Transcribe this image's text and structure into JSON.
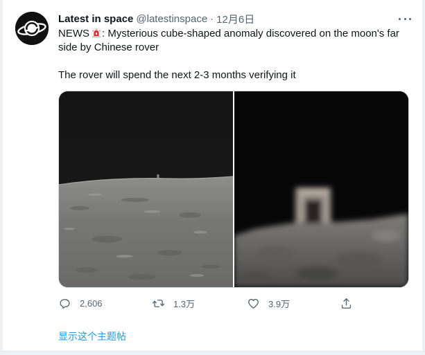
{
  "tweet": {
    "author": {
      "display_name": "Latest in space",
      "handle": "@latestinspace",
      "avatar_icon": "saturn-planet-icon"
    },
    "separator": "·",
    "date": "12月6日",
    "text_parts": {
      "prefix": "NEWS",
      "emoji_icon": "police-siren-icon",
      "line1_rest": ": Mysterious cube-shaped anomaly discovered on the moon's far",
      "line2": "side by Chinese rover",
      "line3": "The rover will spend the next 2-3 months verifying it"
    },
    "media": [
      {
        "name": "lunar-horizon-photo"
      },
      {
        "name": "zoomed-cube-object-photo"
      }
    ],
    "actions": {
      "reply": {
        "icon": "reply-bubble-icon",
        "count": "2,606"
      },
      "retweet": {
        "icon": "retweet-arrows-icon",
        "count": "1.3万"
      },
      "like": {
        "icon": "heart-icon",
        "count": "3.9万"
      },
      "share": {
        "icon": "share-upload-icon"
      }
    },
    "show_thread_label": "显示这个主题帖"
  },
  "colors": {
    "text_primary": "#0f1419",
    "text_secondary": "#536471",
    "link": "#1d9bf0",
    "border": "#cfd9de"
  }
}
